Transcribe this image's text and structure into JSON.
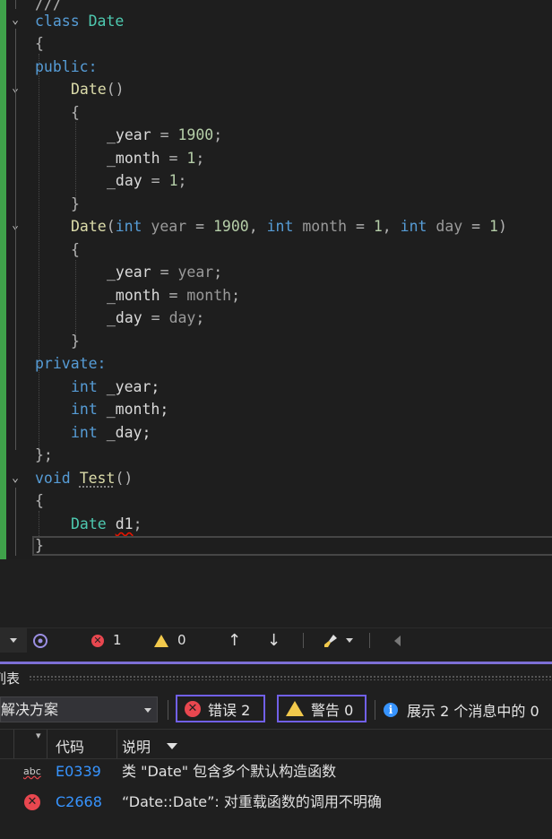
{
  "editor": {
    "lines": {
      "l0": "///",
      "l1_kw": "class",
      "l1_name": "Date",
      "l2": "{",
      "l3": "public:",
      "l4_fn": "Date",
      "l4_rest": "()",
      "l5": "{",
      "l6_mem": "_year",
      "l6_eq": " = ",
      "l6_num": "1900",
      "l6_end": ";",
      "l7_mem": "_month",
      "l7_eq": " = ",
      "l7_num": "1",
      "l7_end": ";",
      "l8_mem": "_day",
      "l8_eq": " = ",
      "l8_num": "1",
      "l8_end": ";",
      "l9": "}",
      "l10_fn": "Date",
      "l10_p1": "(",
      "l10_int1": "int",
      "l10_year": " year",
      "l10_eq1": " = ",
      "l10_n1": "1900",
      "l10_c1": ", ",
      "l10_int2": "int",
      "l10_month": " month",
      "l10_eq2": " = ",
      "l10_n2": "1",
      "l10_c2": ", ",
      "l10_int3": "int",
      "l10_day": " day",
      "l10_eq3": " = ",
      "l10_n3": "1",
      "l10_p2": ")",
      "l11": "{",
      "l12_mem": "_year",
      "l12_eq": " = ",
      "l12_val": "year",
      "l12_end": ";",
      "l13_mem": "_month",
      "l13_eq": " = ",
      "l13_val": "month",
      "l13_end": ";",
      "l14_mem": "_day",
      "l14_eq": " = ",
      "l14_val": "day",
      "l14_end": ";",
      "l15": "}",
      "l16": "private:",
      "l17_kw": "int",
      "l17_mem": " _year;",
      "l18_kw": "int",
      "l18_mem": " _month;",
      "l19_kw": "int",
      "l19_mem": " _day;",
      "l20": "};",
      "l21_kw": "void",
      "l21_fn": "Test",
      "l21_rest": "()",
      "l22": "{",
      "l23_ty": "Date",
      "l23_var": "d1",
      "l23_end": ";",
      "l24": "}"
    }
  },
  "statusbar": {
    "error_count": "1",
    "warning_count": "0",
    "error_icon": "error-circle-icon",
    "warning_icon": "warning-triangle-icon"
  },
  "panel": {
    "title_fragment": "列表"
  },
  "toolbar": {
    "scope_value": "解决方案",
    "errors_label": "错误 2",
    "warnings_label": "警告 0",
    "messages_label": "展示 2 个消息中的 0"
  },
  "list": {
    "headers": {
      "code": "代码",
      "description": "说明"
    },
    "rows": [
      {
        "icon": "spell-check-icon",
        "code": "E0339",
        "description": "类 \"Date\" 包含多个默认构造函数"
      },
      {
        "icon": "error-circle-icon",
        "code": "C2668",
        "description": "“Date::Date”: 对重载函数的调用不明确"
      }
    ]
  },
  "colors": {
    "accent": "#7160e8",
    "error": "#e8474f",
    "warning": "#f2c94c",
    "link": "#3794ff",
    "change_bar": "#3fa24a"
  }
}
